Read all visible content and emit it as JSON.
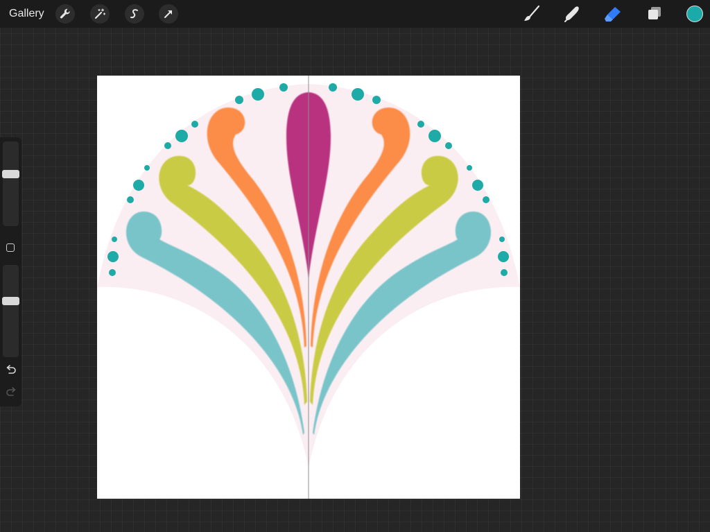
{
  "app": {
    "gallery_label": "Gallery",
    "current_color": "#1ca9a9"
  },
  "toolbar": {
    "left_tools": [
      {
        "name": "actions",
        "icon": "wrench-icon"
      },
      {
        "name": "adjustments",
        "icon": "magic-wand-icon"
      },
      {
        "name": "selection",
        "icon": "selection-s-icon"
      },
      {
        "name": "transform",
        "icon": "arrow-cursor-icon"
      }
    ],
    "right_tools": [
      {
        "name": "brush",
        "icon": "brush-icon"
      },
      {
        "name": "smudge",
        "icon": "smudge-finger-icon"
      },
      {
        "name": "eraser",
        "icon": "eraser-icon",
        "active": true
      },
      {
        "name": "layers",
        "icon": "layers-icon"
      }
    ],
    "active_tool_color": "#2f7cf6"
  },
  "sidebar": {
    "brush_size": 0.63,
    "brush_opacity": 0.62,
    "undo_icon": "undo-arrow-icon",
    "redo_icon": "redo-arrow-icon"
  },
  "canvas": {
    "background_color": "#ffffff",
    "symmetry_guide": "vertical",
    "artwork": {
      "shape_fill": "#fbeef3",
      "colors": {
        "magenta": "#b8317f",
        "orange": "#fb8d4a",
        "lime": "#cacb44",
        "blue": "#79c4c9",
        "teal": "#1eaaa6"
      }
    }
  }
}
